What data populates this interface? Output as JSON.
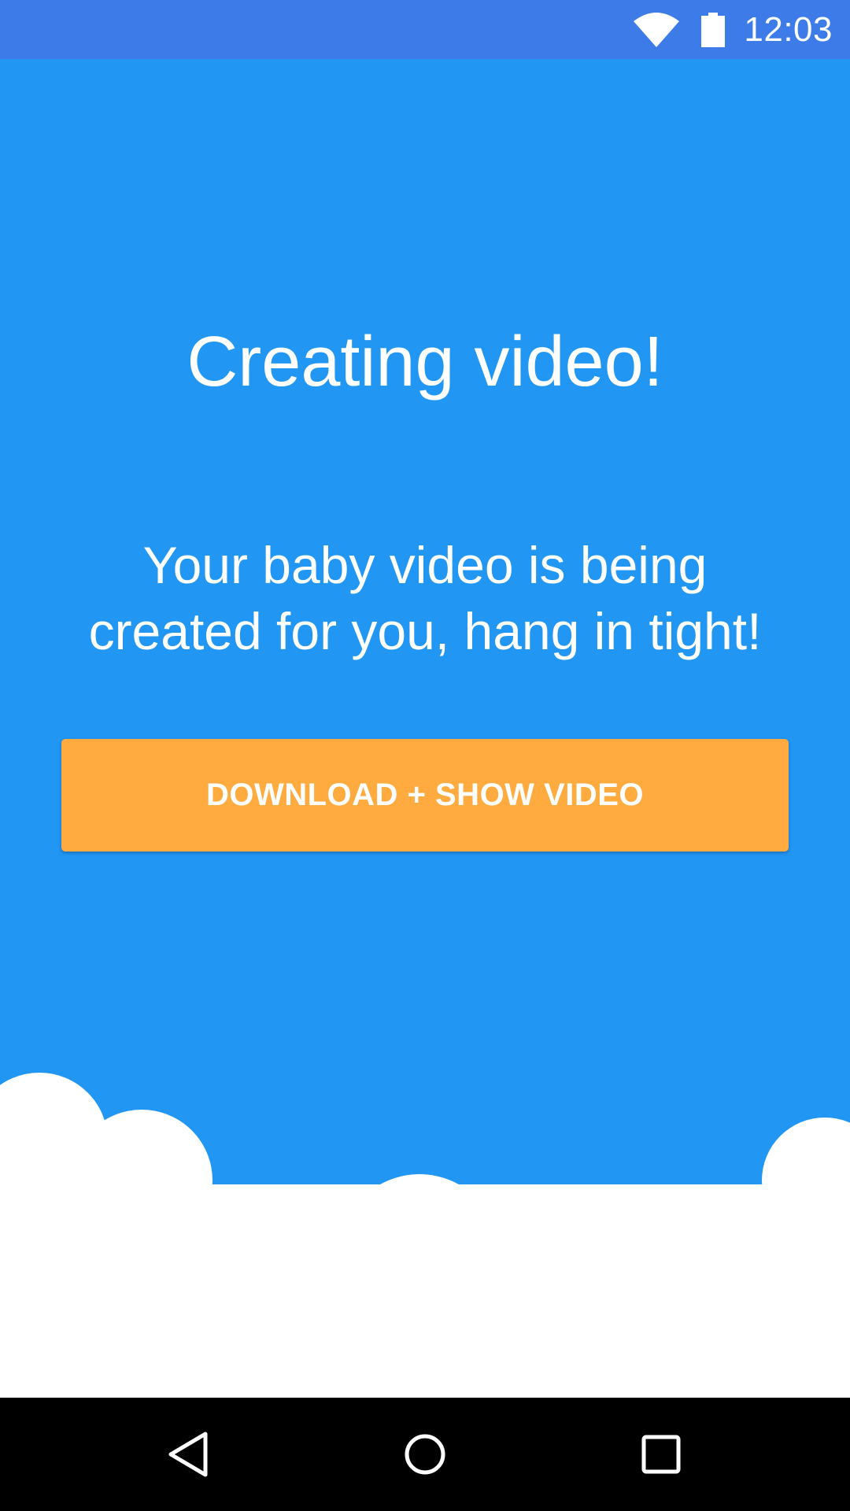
{
  "status_bar": {
    "time": "12:03",
    "icons": [
      "wifi-icon",
      "battery-icon"
    ],
    "background_color": "#3D7BE8"
  },
  "screen": {
    "title": "Creating video!",
    "message": "Your baby video is being created for you, hang in tight!",
    "background_color": "#2196F3"
  },
  "actions": {
    "download_label": "DOWNLOAD + SHOW VIDEO",
    "button_color": "#FFAB40"
  },
  "navigation": {
    "buttons": [
      "back-icon",
      "home-icon",
      "recents-icon"
    ]
  }
}
